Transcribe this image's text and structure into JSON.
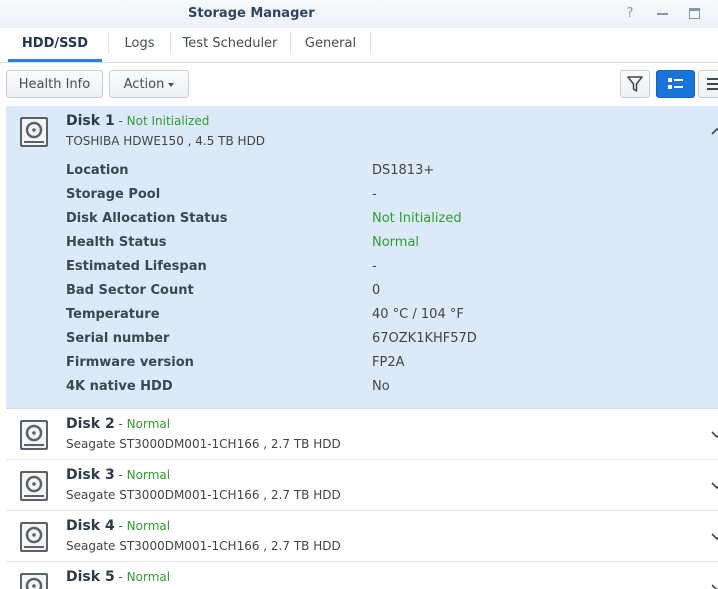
{
  "window": {
    "title": "Storage Manager",
    "help_glyph": "?"
  },
  "tabs": [
    {
      "label": "HDD/SSD",
      "active": true
    },
    {
      "label": "Logs",
      "active": false
    },
    {
      "label": "Test Scheduler",
      "active": false
    },
    {
      "label": "General",
      "active": false
    }
  ],
  "toolbar": {
    "health_info_label": "Health Info",
    "action_label": "Action",
    "filter_icon": "filter-icon",
    "list_view_icon": "list-view-icon",
    "compact_view_icon": "compact-view-icon"
  },
  "colors": {
    "accent": "#1a73d8",
    "status_green": "#2f9e2f",
    "expanded_row_bg": "#dce9f8",
    "title_text": "#2e4663"
  },
  "disks": [
    {
      "name": "Disk 1",
      "status": "Not Initialized",
      "model": "TOSHIBA HDWE150 , 4.5 TB HDD",
      "expanded": true,
      "details": [
        {
          "label": "Location",
          "value": "DS1813+"
        },
        {
          "label": "Storage Pool",
          "value": "-"
        },
        {
          "label": "Disk Allocation Status",
          "value": "Not Initialized"
        },
        {
          "label": "Health Status",
          "value": "Normal"
        },
        {
          "label": "Estimated Lifespan",
          "value": "-"
        },
        {
          "label": "Bad Sector Count",
          "value": "0"
        },
        {
          "label": "Temperature",
          "value": "40 °C / 104 °F"
        },
        {
          "label": "Serial number",
          "value": "67OZK1KHF57D"
        },
        {
          "label": "Firmware version",
          "value": "FP2A"
        },
        {
          "label": "4K native HDD",
          "value": "No"
        }
      ]
    },
    {
      "name": "Disk 2",
      "status": "Normal",
      "model": "Seagate ST3000DM001-1CH166 , 2.7 TB HDD",
      "expanded": false
    },
    {
      "name": "Disk 3",
      "status": "Normal",
      "model": "Seagate ST3000DM001-1CH166 , 2.7 TB HDD",
      "expanded": false
    },
    {
      "name": "Disk 4",
      "status": "Normal",
      "model": "Seagate ST3000DM001-1CH166 , 2.7 TB HDD",
      "expanded": false
    },
    {
      "name": "Disk 5",
      "status": "Normal",
      "model": "",
      "expanded": false
    }
  ]
}
